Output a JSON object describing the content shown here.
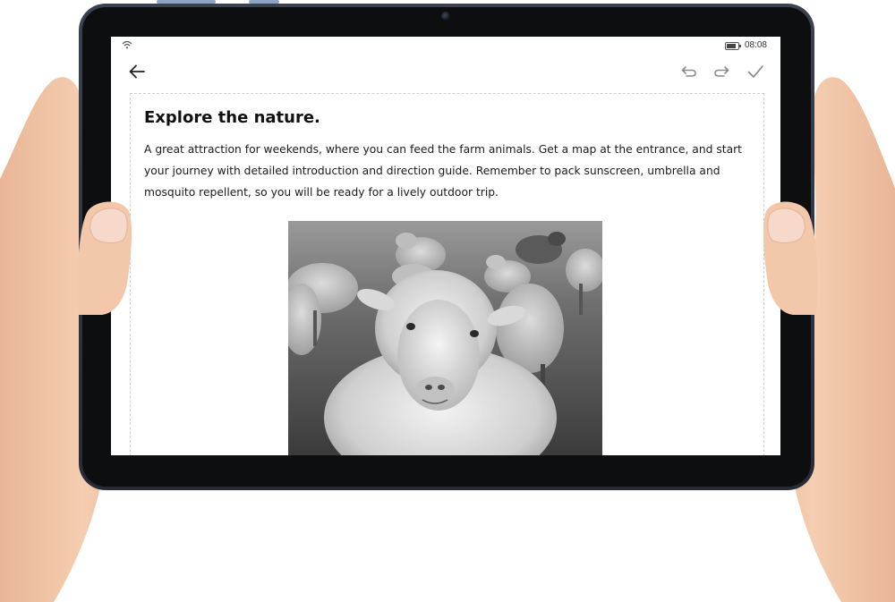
{
  "status_bar": {
    "time": "08:08",
    "battery_level": 0.8,
    "icons": [
      "wifi-icon",
      "battery-icon"
    ]
  },
  "toolbar": {
    "icons": [
      "back-arrow-icon",
      "undo-icon",
      "redo-icon",
      "check-icon"
    ]
  },
  "note": {
    "title": "Explore the nature.",
    "body": "A great attraction for weekends, where you can feed the farm animals. Get a map at the entrance, and start your journey with detailed introduction and direction guide. Remember to pack sunscreen, umbrella and mosquito repellent, so you will be ready for a lively outdoor trip.",
    "image_subject": "sheep-photo"
  },
  "colors": {
    "bezel": "#0d0e10",
    "frame": "#2f3542",
    "screen_bg": "#ffffff",
    "text": "#111111",
    "icon_gray": "#8a8a8a",
    "skin": "#f1c3a6"
  }
}
